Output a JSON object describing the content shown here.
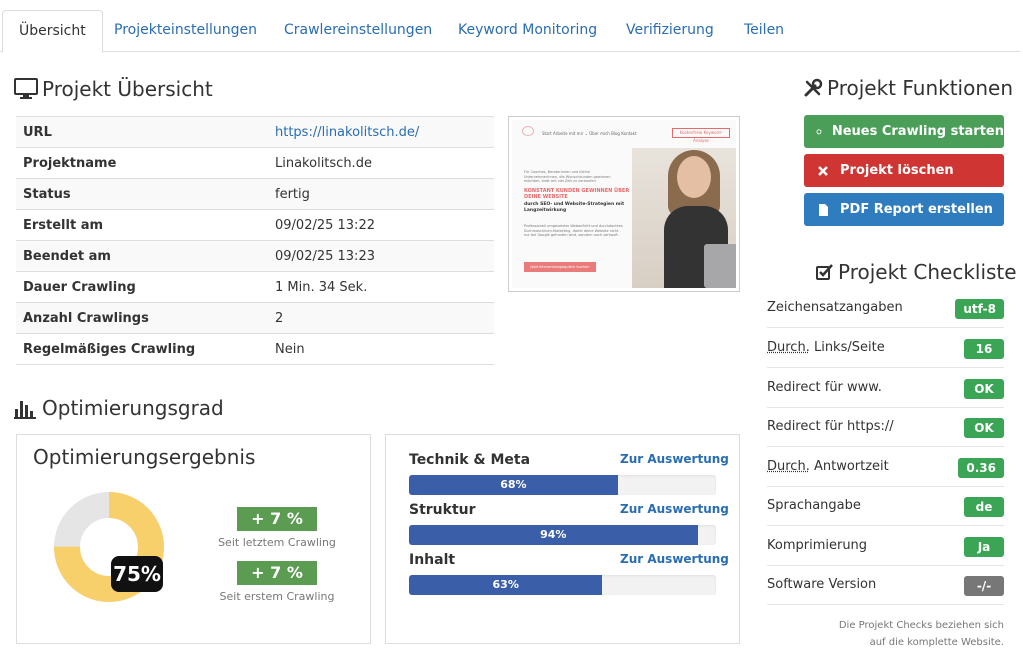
{
  "tabs": [
    "Übersicht",
    "Projekteinstellungen",
    "Crawlereinstellungen",
    "Keyword Monitoring",
    "Verifizierung",
    "Teilen"
  ],
  "overview": {
    "title": "Projekt Übersicht",
    "rows": [
      {
        "key": "URL",
        "value": "https://linakolitsch.de/"
      },
      {
        "key": "Projektname",
        "value": "Linakolitsch.de"
      },
      {
        "key": "Status",
        "value": "fertig"
      },
      {
        "key": "Erstellt am",
        "value": "09/02/25 13:22"
      },
      {
        "key": "Beendet am",
        "value": "09/02/25 13:23"
      },
      {
        "key": "Dauer Crawling",
        "value": "1 Min. 34 Sek."
      },
      {
        "key": "Anzahl Crawlings",
        "value": "2"
      },
      {
        "key": "Regelmäßiges Crawling",
        "value": "Nein"
      }
    ]
  },
  "thumbnail": {
    "nav": "Start     Arbeite mit mir ⌄     Über mich     Blog     Kontakt",
    "button": "Kostenfreie Keyword-Analyse",
    "intro": "Für Coaches, Beraterinnen und kleine Unternehmerinnen, die Wunschkunden gewinnen möchten, statt mit viel Zeit zu verkaufen",
    "headline": "KONSTANT KUNDEN GEWINNEN ÜBER DEINE WEBSITE",
    "subline": "durch SEO- und Website-Strategien mit Langzeitwirkung",
    "body": "Professionell umgesetzter Webauftritt und durchdachtes Suchmaschinen-Marketing, damit deine Website nicht nur bei Google gefunden wird, sondern auch verkauft.",
    "cta": "Jetzt Kennenlerngespräch buchen"
  },
  "optimization": {
    "title": "Optimierungsgrad",
    "result_title": "Optimierungsergebnis",
    "score": 75,
    "score_label": "75%",
    "change_last": "+ 7 %",
    "change_last_label": "Seit letztem Crawling",
    "change_first": "+ 7 %",
    "change_first_label": "Seit erstem Crawling",
    "donut_colors": {
      "filled": "#f7d06b",
      "empty": "#e5e5e5"
    },
    "categories": [
      {
        "name": "Technik & Meta",
        "link": "Zur Auswertung",
        "value": 68,
        "label": "68%"
      },
      {
        "name": "Struktur",
        "link": "Zur Auswertung",
        "value": 94,
        "label": "94%"
      },
      {
        "name": "Inhalt",
        "link": "Zur Auswertung",
        "value": 63,
        "label": "63%"
      }
    ]
  },
  "functions": {
    "title": "Projekt Funktionen",
    "buttons": [
      {
        "label": "Neues Crawling starten",
        "icon": "refresh-icon",
        "color": "#4a9e57"
      },
      {
        "label": "Projekt löschen",
        "icon": "close-icon",
        "color": "#cf3532"
      },
      {
        "label": "PDF Report erstellen",
        "icon": "file-icon",
        "color": "#2f7cbf"
      }
    ]
  },
  "checklist": {
    "title": "Projekt Checkliste",
    "items": [
      {
        "label": "Zeichensatzangaben",
        "value": "utf-8",
        "color": "#3aa655"
      },
      {
        "abbr": "Durch.",
        "label": " Links/Seite",
        "value": "16",
        "color": "#3aa655"
      },
      {
        "label": "Redirect für www.",
        "value": "OK",
        "color": "#3aa655"
      },
      {
        "label": "Redirect für https://",
        "value": "OK",
        "color": "#3aa655"
      },
      {
        "abbr": "Durch.",
        "label": " Antwortzeit",
        "value": "0.36",
        "color": "#3aa655"
      },
      {
        "label": "Sprachangabe",
        "value": "de",
        "color": "#3aa655"
      },
      {
        "label": "Komprimierung",
        "value": "Ja",
        "color": "#3aa655"
      },
      {
        "label": "Software Version",
        "value": "-/-",
        "color": "#777777"
      }
    ],
    "note": "Die Projekt Checks beziehen sich auf die komplette Website."
  }
}
